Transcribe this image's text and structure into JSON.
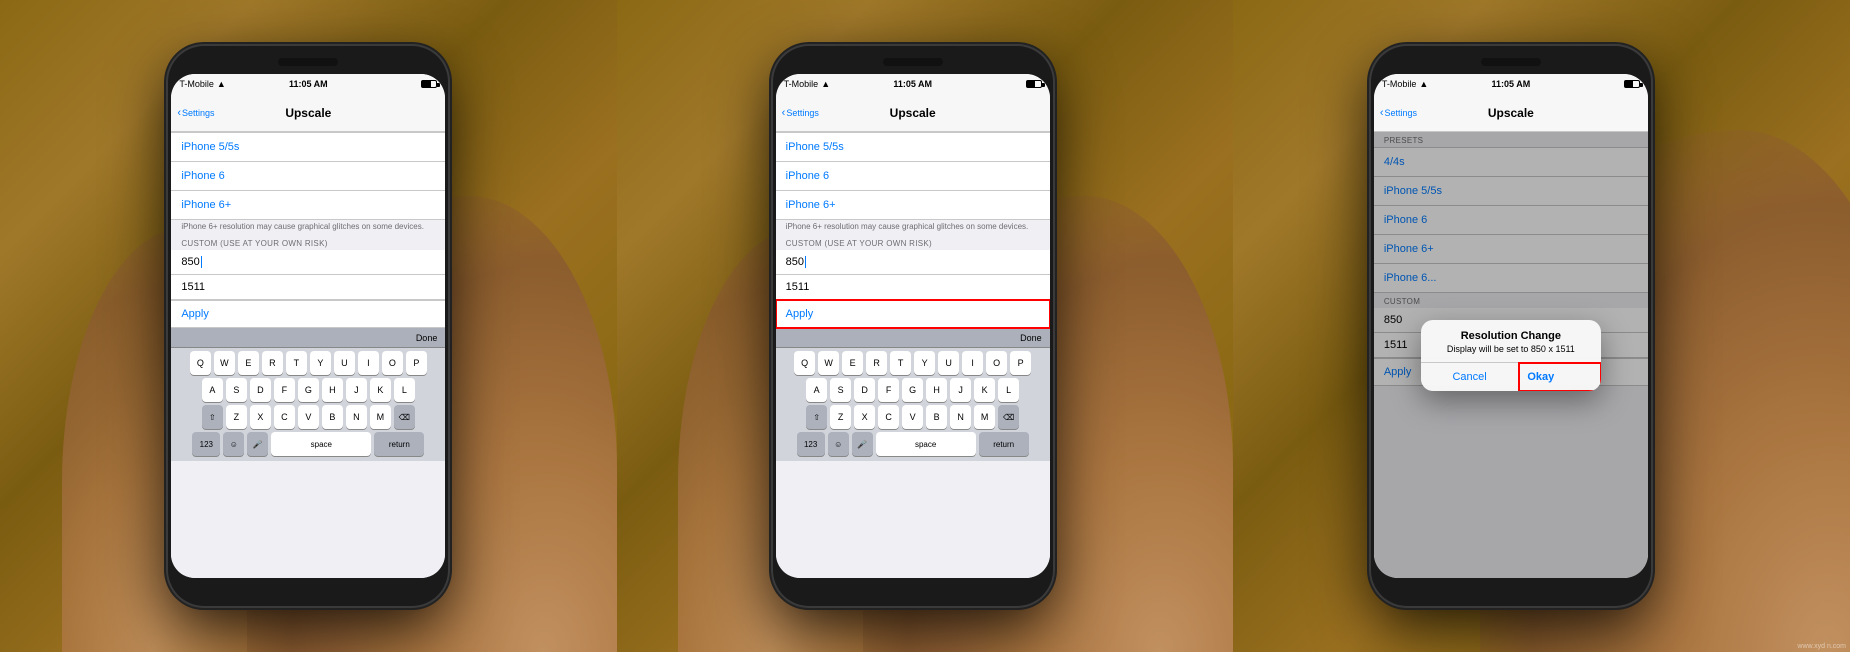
{
  "panels": [
    {
      "id": "panel1",
      "status_bar": {
        "carrier": "T-Mobile",
        "signal": "●●●●",
        "wifi": "▲",
        "time": "11:05 AM",
        "battery": "■"
      },
      "nav": {
        "back": "Settings",
        "title": "Upscale"
      },
      "presets": {
        "label": "",
        "items": [
          "iPhone 5/5s",
          "iPhone 6",
          "iPhone 6+"
        ]
      },
      "warning": "iPhone 6+ resolution may cause graphical glitches on some devices.",
      "custom_label": "CUSTOM (USE AT YOUR OWN RISK)",
      "field1": "850",
      "field2": "1511",
      "apply": "Apply",
      "has_keyboard": true,
      "has_highlight": false
    },
    {
      "id": "panel2",
      "status_bar": {
        "carrier": "T-Mobile",
        "signal": "●●●●",
        "wifi": "▲",
        "time": "11:05 AM",
        "battery": "■"
      },
      "nav": {
        "back": "Settings",
        "title": "Upscale"
      },
      "presets": {
        "label": "",
        "items": [
          "iPhone 5/5s",
          "iPhone 6",
          "iPhone 6+"
        ]
      },
      "warning": "iPhone 6+ resolution may cause graphical glitches on some devices.",
      "custom_label": "CUSTOM (USE AT YOUR OWN RISK)",
      "field1": "850",
      "field2": "1511",
      "apply": "Apply",
      "has_keyboard": true,
      "has_highlight": true,
      "highlight_target": "apply"
    },
    {
      "id": "panel3",
      "status_bar": {
        "carrier": "T-Mobile",
        "signal": "●●●●",
        "wifi": "▲",
        "time": "11:05 AM",
        "battery": "■"
      },
      "nav": {
        "back": "Settings",
        "title": "Upscale"
      },
      "presets_label": "PRESETS",
      "presets": {
        "items": [
          "4/4s",
          "iPhone 5/5s",
          "iPhone 6",
          "iPhone 6+",
          "iPhone 6..."
        ]
      },
      "custom_label": "CUSTOM",
      "field1": "850",
      "field2": "1511",
      "apply": "Apply",
      "has_keyboard": false,
      "has_dialog": true,
      "dialog": {
        "title": "Resolution Change",
        "message": "Display will be set to 850 x 1511",
        "cancel": "Cancel",
        "okay": "Okay"
      },
      "has_highlight": true,
      "highlight_target": "okay"
    }
  ],
  "keyboard": {
    "rows": [
      [
        "Q",
        "W",
        "E",
        "R",
        "T",
        "Y",
        "U",
        "I",
        "O",
        "P"
      ],
      [
        "A",
        "S",
        "D",
        "F",
        "G",
        "H",
        "J",
        "K",
        "L"
      ],
      [
        "⇧",
        "Z",
        "X",
        "C",
        "V",
        "B",
        "N",
        "M",
        "⌫"
      ],
      [
        "123",
        "😊",
        "🎤",
        "space",
        "return"
      ]
    ]
  },
  "watermark": "www.xyd n.com"
}
